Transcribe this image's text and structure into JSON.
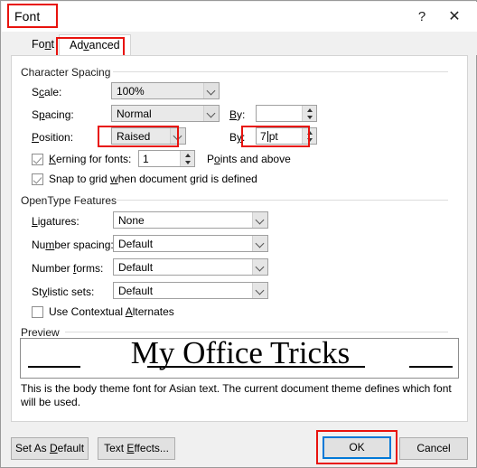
{
  "window": {
    "title": "Font",
    "help_icon": "question-mark-icon",
    "close_icon": "close-icon"
  },
  "tabs": [
    {
      "label": "Font",
      "key": "font",
      "selected": false
    },
    {
      "label": "Advanced",
      "key": "advanced",
      "selected": true
    }
  ],
  "character_spacing": {
    "group_label": "Character Spacing",
    "scale": {
      "label": "Scale:",
      "value": "100%"
    },
    "spacing": {
      "label": "Spacing:",
      "value": "Normal",
      "by_label": "By:",
      "by_value": ""
    },
    "position": {
      "label": "Position:",
      "value": "Raised",
      "by_label": "By:",
      "by_value": "7 pt"
    },
    "kerning": {
      "label": "Kerning for fonts:",
      "checked": true,
      "value": "1",
      "suffix": "Points and above"
    },
    "snap_to_grid": {
      "label": "Snap to grid when document grid is defined",
      "checked": true
    }
  },
  "opentype": {
    "group_label": "OpenType Features",
    "ligatures": {
      "label": "Ligatures:",
      "value": "None"
    },
    "number_spacing": {
      "label": "Number spacing:",
      "value": "Default"
    },
    "number_forms": {
      "label": "Number forms:",
      "value": "Default"
    },
    "stylistic_sets": {
      "label": "Stylistic sets:",
      "value": "Default"
    },
    "contextual_alternates": {
      "label": "Use Contextual Alternates",
      "checked": false
    }
  },
  "preview": {
    "group_label": "Preview",
    "sample_text": "My Office Tricks",
    "description": "This is the body theme font for Asian text. The current document theme defines which font will be used."
  },
  "buttons": {
    "set_as_default": "Set As Default",
    "text_effects": "Text Effects...",
    "ok": "OK",
    "cancel": "Cancel"
  },
  "annotations": {
    "highlight_color": "#e8130e",
    "focus_color": "#0078d7",
    "highlighted": [
      "title",
      "advanced-tab",
      "position-combo",
      "position-by-spinner",
      "ok-button"
    ]
  }
}
